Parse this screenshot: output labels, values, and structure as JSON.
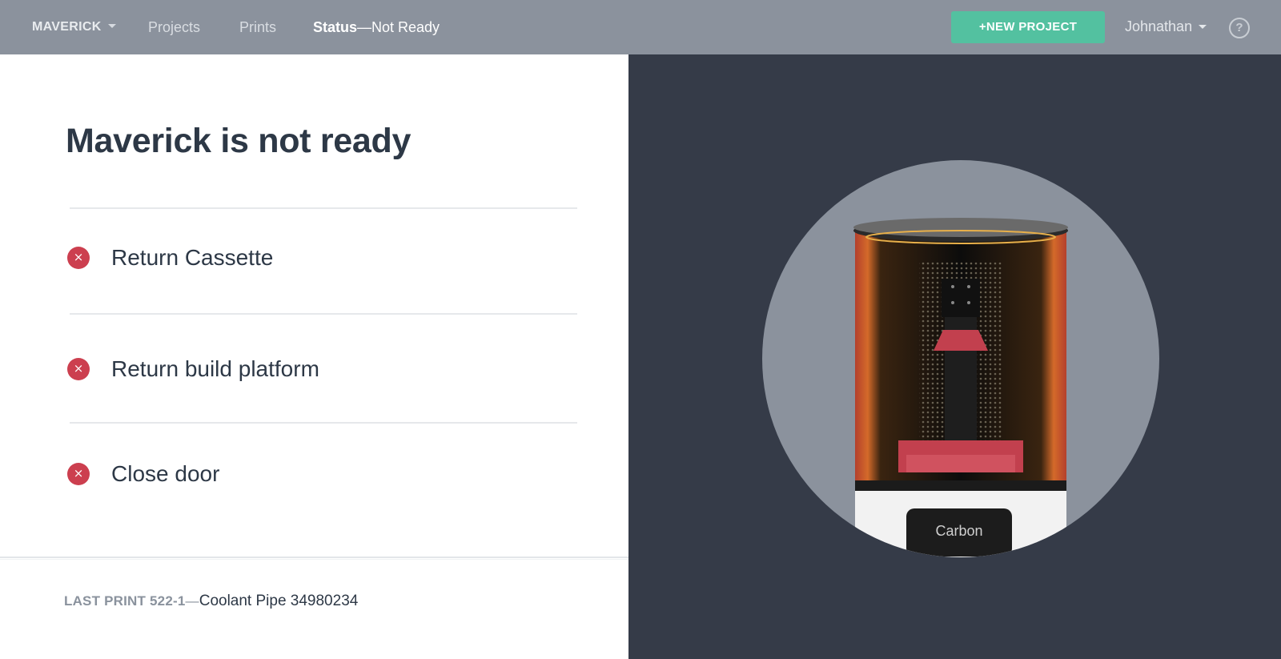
{
  "nav": {
    "brand": "MAVERICK",
    "projects": "Projects",
    "prints": "Prints",
    "status_label": "Status",
    "status_value": "—Not Ready",
    "new_project": "+NEW PROJECT",
    "user": "Johnathan",
    "help": "?"
  },
  "main": {
    "title": "Maverick is not ready",
    "checklist": [
      {
        "label": "Return Cassette",
        "state": "error"
      },
      {
        "label": "Return build platform",
        "state": "error"
      },
      {
        "label": "Close door",
        "state": "error"
      }
    ],
    "error_icon_glyph": "×",
    "last_print_label": "LAST PRINT 522-1",
    "last_print_sep": "—",
    "last_print_name": "Coolant Pipe 34980234"
  },
  "printer": {
    "brand_label": "Carbon"
  },
  "colors": {
    "nav_bg": "#8b929d",
    "accent_button": "#53c1a0",
    "error": "#cc3f4f",
    "dark_panel": "#353b48",
    "text_dark": "#2d3846"
  }
}
